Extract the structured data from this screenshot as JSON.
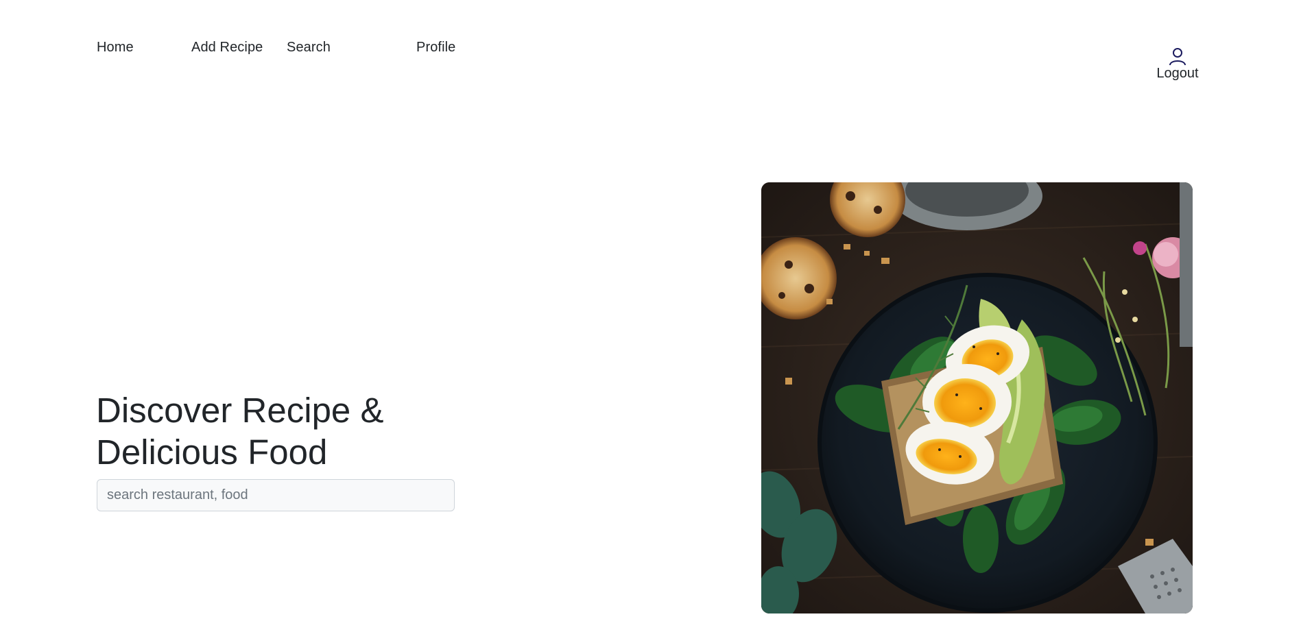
{
  "nav": {
    "home": "Home",
    "add_recipe": "Add Recipe",
    "search": "Search",
    "profile": "Profile",
    "logout": "Logout",
    "logout_icon": "user-icon"
  },
  "hero": {
    "title_line1": "Discover Recipe &",
    "title_line2": "Delicious Food",
    "search_placeholder": "search restaurant, food"
  },
  "colors": {
    "text": "#212529",
    "input_bg": "#f8f9fa",
    "input_border": "#ced4da",
    "icon_stroke": "#1a1a5e"
  }
}
